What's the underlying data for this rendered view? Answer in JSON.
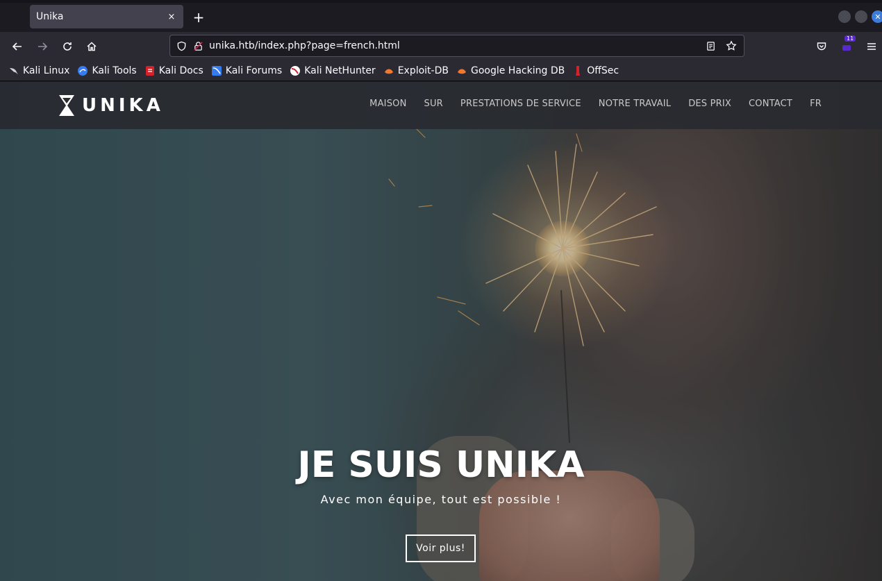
{
  "browser": {
    "tab": {
      "title": "Unika",
      "close": "×"
    },
    "new_tab": "+",
    "window_close": "✕",
    "url": "unika.htb/index.php?page=french.html",
    "extension_badge": "11",
    "bookmarks": [
      {
        "label": "Kali Linux",
        "color": "#3a3a3a"
      },
      {
        "label": "Kali Tools",
        "color": "#367bf0"
      },
      {
        "label": "Kali Docs",
        "color": "#d3222a"
      },
      {
        "label": "Kali Forums",
        "color": "#367bf0"
      },
      {
        "label": "Kali NetHunter",
        "color": "#d3222a"
      },
      {
        "label": "Exploit-DB",
        "color": "#f4772e"
      },
      {
        "label": "Google Hacking DB",
        "color": "#f4772e"
      },
      {
        "label": "OffSec",
        "color": "#d3222a"
      }
    ]
  },
  "site": {
    "logo": "UNIKA",
    "menu": [
      "MAISON",
      "SUR",
      "PRESTATIONS DE SERVICE",
      "NOTRE TRAVAIL",
      "DES PRIX",
      "CONTACT",
      "FR"
    ],
    "hero": {
      "title": "JE SUIS UNIKA",
      "subtitle": "Avec mon équipe, tout est possible !",
      "button": "Voir plus!"
    }
  }
}
